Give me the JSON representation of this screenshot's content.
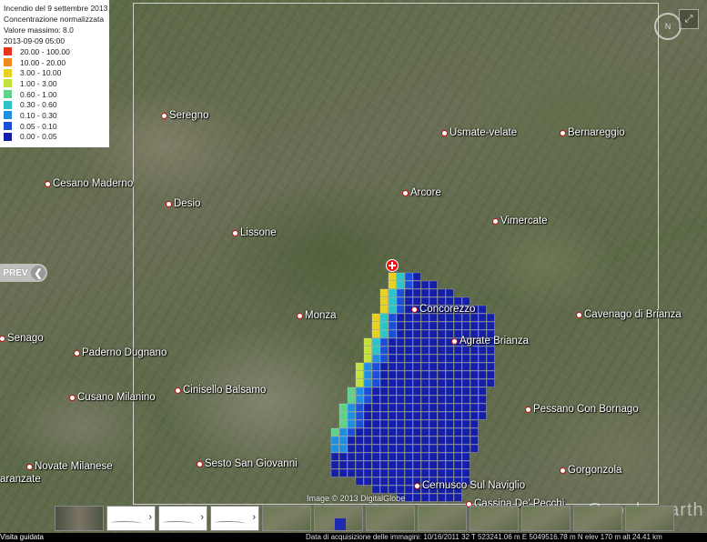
{
  "legend": {
    "title": "Incendio del 9 settembre 2013",
    "subtitle": "Concentrazione normalizzata",
    "max_value": "Valore massimo: 8.0",
    "timestamp": "2013-09-09 05:00",
    "bins": [
      {
        "label": "20.00 - 100.00",
        "color": "#e8341c"
      },
      {
        "label": "10.00 - 20.00",
        "color": "#f08a1c"
      },
      {
        "label": "3.00 - 10.00",
        "color": "#e9d21f"
      },
      {
        "label": "1.00 - 3.00",
        "color": "#c4e23c"
      },
      {
        "label": "0.60 - 1.00",
        "color": "#5fd28a"
      },
      {
        "label": "0.30 - 0.60",
        "color": "#2bc4c8"
      },
      {
        "label": "0.10 - 0.30",
        "color": "#1f8ee0"
      },
      {
        "label": "0.05 - 0.10",
        "color": "#1c4fd8"
      },
      {
        "label": "0.00 - 0.05",
        "color": "#151ea6"
      }
    ]
  },
  "places": [
    {
      "name": "Seregno"
    },
    {
      "name": "Usmate-velate"
    },
    {
      "name": "Bernareggio"
    },
    {
      "name": "Cesano Maderno"
    },
    {
      "name": "Desio"
    },
    {
      "name": "Arcore"
    },
    {
      "name": "Vimercate"
    },
    {
      "name": "Lissone"
    },
    {
      "name": "Monza"
    },
    {
      "name": "Concorezzo"
    },
    {
      "name": "Cavenago di Brianza"
    },
    {
      "name": "Agrate Brianza"
    },
    {
      "name": "Senago"
    },
    {
      "name": "Paderno Dugnano"
    },
    {
      "name": "Cusano Milanino"
    },
    {
      "name": "Cinisello Balsamo"
    },
    {
      "name": "Pessano Con Bornago"
    },
    {
      "name": "Novate Milanese"
    },
    {
      "name": "Sesto San Giovanni"
    },
    {
      "name": "Gorgonzola"
    },
    {
      "name": "Cernusco Sul Naviglio"
    },
    {
      "name": "Cassina De' Pecchi"
    },
    {
      "name": "aranzate"
    }
  ],
  "ui": {
    "prev_label": "PREV",
    "prev_arrow": "❮",
    "compass_label": "N",
    "fullscreen_icon": "⤢",
    "copyright": "Image © 2013 DigitalGlobe",
    "brand": "Google earth",
    "thumb_chevron": "›"
  },
  "statusbar": {
    "tour_label": "Visita guidata",
    "info": "Data di acquisizione delle immagini: 10/16/2011    32 T 523241.06 m E 5049516.78 m N  elev  170 m    alt  24.41 km"
  }
}
